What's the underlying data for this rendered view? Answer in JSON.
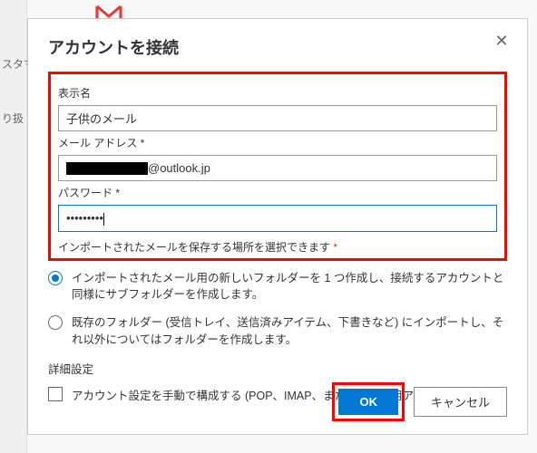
{
  "bg": {
    "text1": "スタマ",
    "text2": "り扱"
  },
  "dialog": {
    "title": "アカウントを接続",
    "fields": {
      "display_name": {
        "label": "表示名",
        "value": "子供のメール"
      },
      "email": {
        "label": "メール アドレス *",
        "domain": "@outlook.jp"
      },
      "password": {
        "label": "パスワード *",
        "value": "•••••••••"
      },
      "import_note": "インポートされたメールを保存する場所を選択できます",
      "import_asterisk": "*"
    },
    "radios": {
      "opt1": "インポートされたメール用の新しいフォルダーを 1 つ作成し、接続するアカウントと同様にサブフォルダーを作成します。",
      "opt2": "既存のフォルダー (受信トレイ、送信済みアイテム、下書きなど) にインポートし、それ以外についてはフォルダーを作成します。"
    },
    "advanced": {
      "label": "詳細設定",
      "checkbox": "アカウント設定を手動で構成する (POP、IMAP、または送信専用アカウント)"
    },
    "buttons": {
      "ok": "OK",
      "cancel": "キャンセル"
    }
  }
}
